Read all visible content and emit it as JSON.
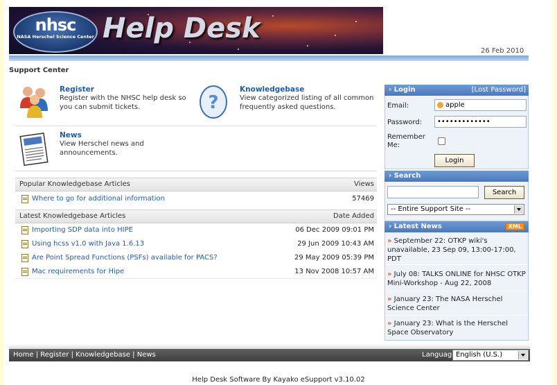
{
  "header": {
    "logo_main": "nhsc",
    "logo_sub": "NASA Herschel Science Center",
    "banner_title": "Help Desk",
    "date": "26 Feb 2010"
  },
  "support_center": "Support Center",
  "features": {
    "register": {
      "title": "Register",
      "desc": "Register with the NHSC help desk so you can submit tickets.",
      "icon": "people-icon"
    },
    "knowledgebase": {
      "title": "Knowledgebase",
      "desc": "View categorized listing of all common frequently asked questions.",
      "icon": "question-icon"
    },
    "news": {
      "title": "News",
      "desc": "View Herschel news and announcements.",
      "icon": "newspaper-icon"
    }
  },
  "popular": {
    "header": "Popular Knowledgebase Articles",
    "col": "Views",
    "rows": [
      {
        "title": "Where to go for additional information",
        "value": "57469"
      }
    ]
  },
  "latest": {
    "header": "Latest Knowledgebase Articles",
    "col": "Date Added",
    "rows": [
      {
        "title": "Importing SDP data into HIPE",
        "value": "06 Dec 2009 09:01 PM"
      },
      {
        "title": "Using hcss v1.0 with Java 1.6.13",
        "value": "29 Jun 2009 10:43 AM"
      },
      {
        "title": "Are Point Spread Functions (PSFs) available for PACS?",
        "value": "29 May 2009 05:39 PM"
      },
      {
        "title": "Mac requirements for Hipe",
        "value": "13 Nov 2008 10:57 AM"
      }
    ]
  },
  "login": {
    "title": "Login",
    "lost_password": "[Lost Password]",
    "email_label": "Email:",
    "email_value": "apple",
    "password_label": "Password:",
    "password_value": "•••••••••••••",
    "remember_label": "Remember Me:",
    "button": "Login"
  },
  "search": {
    "title": "Search",
    "input_value": "",
    "button": "Search",
    "scope_selected": "-- Entire Support Site --"
  },
  "latest_news": {
    "title": "Latest News",
    "xml_badge": "XML",
    "items": [
      "September 22: OTKP wiki's unavailable, 23 Sep 09, 13:00-17:00, PDT",
      "July 08: TALKS ONLINE for NHSC OTKP Mini-Workshop - Aug 22, 2008",
      "January 23: The NASA Herschel Science Center",
      "January 23: What is the Herschel Space Observatory"
    ]
  },
  "footer": {
    "links": [
      "Home",
      "Register",
      "Knowledgebase",
      "News"
    ],
    "language_label": "Language:",
    "language_value": "English (U.S.)",
    "powered_by": "Help Desk Software By Kayako eSupport v3.10.02"
  },
  "colors": {
    "link": "#1f5ca8",
    "panel_header": "#4a78bd",
    "footer_bar": "#4a4a4a",
    "outer_bg": "#fdfbd8"
  }
}
